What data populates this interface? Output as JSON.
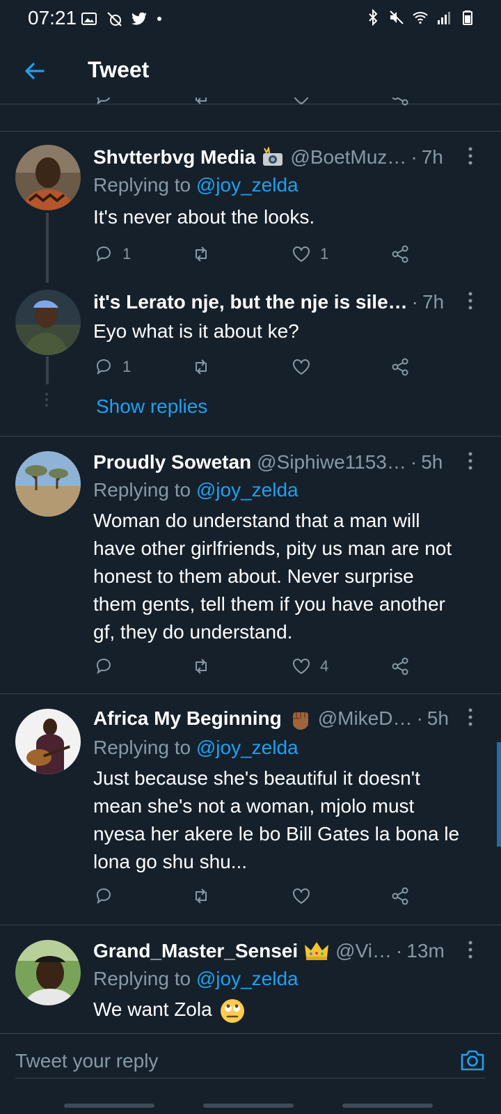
{
  "status_bar": {
    "time": "07:21",
    "left_icons": [
      "gallery-icon",
      "slashed-cast-icon",
      "twitter-bird-icon",
      "notification-dot"
    ],
    "right_icons": [
      "bluetooth-icon",
      "mute-icon",
      "wifi-icon",
      "signal-icon",
      "battery-icon"
    ]
  },
  "header": {
    "title": "Tweet"
  },
  "colors": {
    "background": "#15202b",
    "accent": "#1da1f2",
    "muted": "#8899a6",
    "divider": "#38444d"
  },
  "tweets": [
    {
      "display_name": "Shvtterbvg Media",
      "name_emoji": "camera-flash-emoji",
      "handle": "@BoetMuz…",
      "time": "7h",
      "replying_to_prefix": "Replying to",
      "replying_to": "@joy_zelda",
      "text": "It's never about the looks.",
      "reply_count": "1",
      "like_count": "1"
    },
    {
      "display_name": "it's Lerato nje, but the nje is sile…",
      "time": "7h",
      "text": "Eyo what is it about ke?",
      "reply_count": "1",
      "like_count": ""
    },
    {
      "display_name": "Proudly Sowetan",
      "handle": "@Siphiwe1153…",
      "time": "5h",
      "replying_to_prefix": "Replying to",
      "replying_to": "@joy_zelda",
      "text_lines": [
        "Woman do understand that a man will",
        "have other girlfriends, pity us man are not",
        "honest to them about. Never surprise",
        "them gents, tell them if you have another",
        "gf, they do understand."
      ],
      "reply_count": "",
      "like_count": "4"
    },
    {
      "display_name": "Africa My Beginning",
      "name_emoji": "raised-fist-emoji",
      "handle": "@MikeD…",
      "time": "5h",
      "replying_to_prefix": "Replying to",
      "replying_to": "@joy_zelda",
      "text_lines": [
        "Just because she's beautiful it doesn't",
        "mean she's not a woman, mjolo must",
        "nyesa her akere le bo Bill Gates la bona le",
        "lona go shu shu..."
      ],
      "reply_count": "",
      "like_count": ""
    },
    {
      "display_name": "Grand_Master_Sensei",
      "name_emoji": "crown-emoji",
      "handle": "@Vi…",
      "time": "13m",
      "replying_to_prefix": "Replying to",
      "replying_to": "@joy_zelda",
      "text": "We want Zola",
      "text_emoji": "rolling-eyes-emoji"
    }
  ],
  "show_replies": "Show replies",
  "reply_bar": {
    "placeholder": "Tweet your reply"
  }
}
